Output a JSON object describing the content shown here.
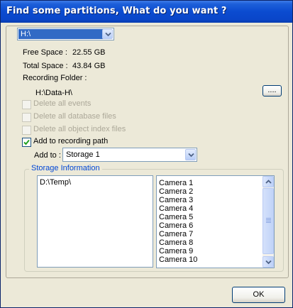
{
  "dialog": {
    "title": "Find some partitions, What do you want ?",
    "drive_selected": "H:\\",
    "free_space_label": "Free Space :",
    "free_space_value": "22.55 GB",
    "total_space_label": "Total Space :",
    "total_space_value": "43.84 GB",
    "recording_folder_label": "Recording Folder :",
    "recording_folder_value": "H:\\Data-H\\",
    "browse_label": "....",
    "options": [
      {
        "label": "Delete all events",
        "checked": false,
        "enabled": false
      },
      {
        "label": "Delete all database files",
        "checked": false,
        "enabled": false
      },
      {
        "label": "Delete all object index files",
        "checked": false,
        "enabled": false
      },
      {
        "label": "Add to recording path",
        "checked": true,
        "enabled": true
      }
    ],
    "add_to_label": "Add to :",
    "add_to_value": "Storage 1",
    "storage_info_label": "Storage Information",
    "storage_paths": [
      "D:\\Temp\\"
    ],
    "cameras": [
      "Camera 1",
      "Camera 2",
      "Camera 3",
      "Camera 4",
      "Camera 5",
      "Camera 6",
      "Camera 7",
      "Camera 8",
      "Camera 9",
      "Camera 10"
    ],
    "ok_label": "OK"
  },
  "colors": {
    "title_bar": "#0a46c9",
    "dialog_bg": "#ece9d8",
    "group_label": "#0046d5",
    "selection": "#316ac5",
    "disabled_text": "#aca899"
  }
}
